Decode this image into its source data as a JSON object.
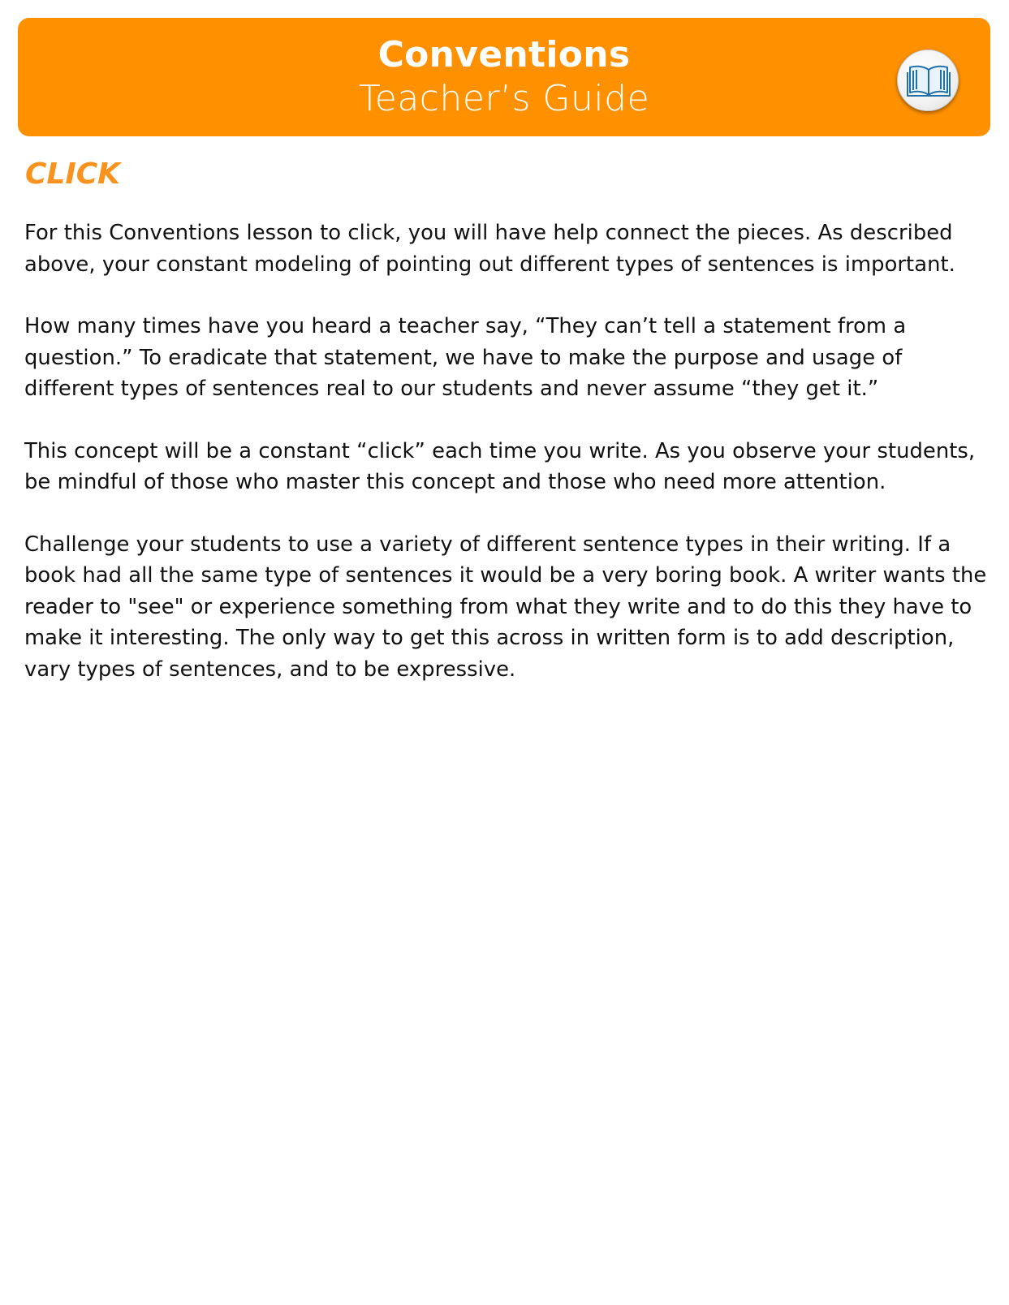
{
  "header": {
    "title": "Conventions",
    "subtitle": "Teacher’s Guide",
    "icon": "book-icon",
    "banner_color": "#ff9100"
  },
  "section": {
    "heading": "CLICK",
    "heading_color": "#f7931e"
  },
  "paragraphs": [
    "For this Conventions lesson to click, you will have help connect the pieces. As described above, your constant modeling of pointing out different types of sentences is important.",
    "How many times have you heard a teacher say, “They can’t tell a statement from a question.” To eradicate that statement, we have to make the purpose and usage of different types of sentences real to our students and never assume “they get it.”",
    "This concept will be a constant “click” each time you write. As you observe your students, be mindful of those who master this concept and those who need more attention.",
    "Challenge your students to use a variety of different sentence types in their writing. If a book had all the same type of sentences it would be a very boring book. A writer wants the reader to \"see\" or experience something from what they write and to do this they have to make it interesting. The only way to get this across in written form is to add description, vary types of sentences, and to be expressive."
  ]
}
